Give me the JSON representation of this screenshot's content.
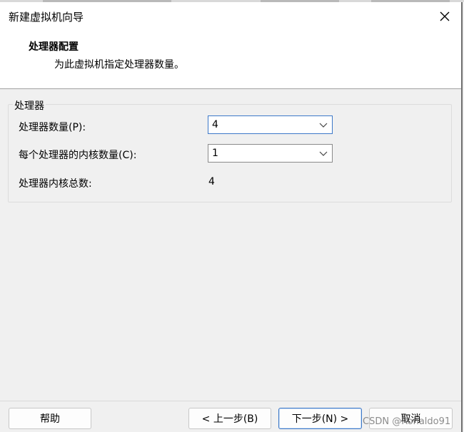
{
  "window": {
    "title": "新建虚拟机向导"
  },
  "header": {
    "title": "处理器配置",
    "subtitle": "为此虚拟机指定处理器数量。"
  },
  "processor_group": {
    "legend": "处理器",
    "processor_count": {
      "label": "处理器数量(P):",
      "value": "4"
    },
    "cores_per_processor": {
      "label": "每个处理器的内核数量(C):",
      "value": "1"
    },
    "total_cores": {
      "label": "处理器内核总数:",
      "value": "4"
    }
  },
  "footer": {
    "help_label": "帮助",
    "back_label": "< 上一步(B)",
    "next_label": "下一步(N) >",
    "cancel_label": "取消"
  },
  "watermark": "CSDN @Ronaldo91",
  "colors": {
    "accent": "#3c78c8",
    "header_bg": "#ffffff",
    "dialog_bg": "#f0f0f0"
  }
}
